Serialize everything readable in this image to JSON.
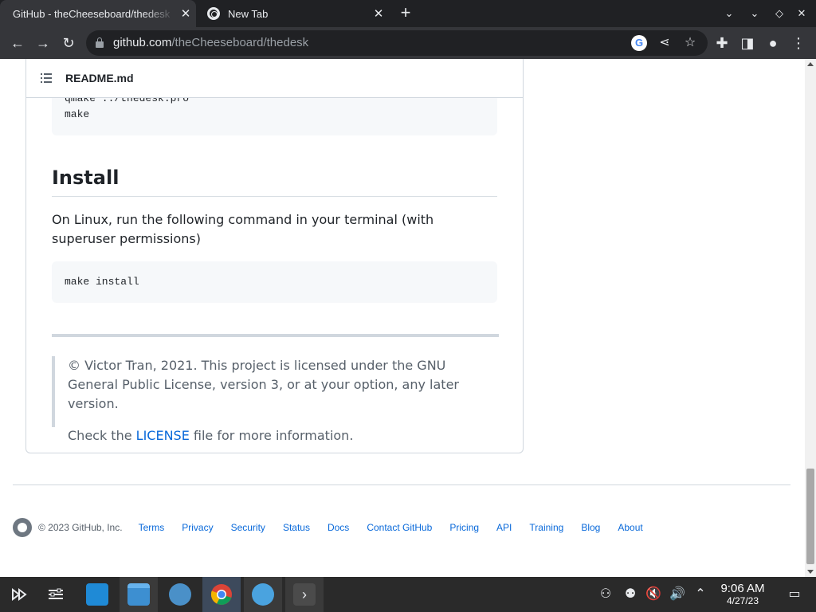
{
  "browser": {
    "tabs": [
      {
        "title": "GitHub - theCheeseboard/thedesk",
        "active": true
      },
      {
        "title": "New Tab",
        "active": false
      }
    ],
    "url_host": "github.com",
    "url_path": "/theCheeseboard/thedesk"
  },
  "readme": {
    "filename": "README.md",
    "build_code": [
      "qmake ../thedesk.pro",
      "make"
    ],
    "install_heading": "Install",
    "install_text": "On Linux, run the following command in your terminal (with superuser permissions)",
    "install_code": "make install",
    "license_text": "© Victor Tran, 2021. This project is licensed under the GNU General Public License, version 3, or at your option, any later version.",
    "check_prefix": "Check the ",
    "license_link": "LICENSE",
    "check_suffix": " file for more information."
  },
  "footer": {
    "copyright": "© 2023 GitHub, Inc.",
    "links": [
      "Terms",
      "Privacy",
      "Security",
      "Status",
      "Docs",
      "Contact GitHub",
      "Pricing",
      "API",
      "Training",
      "Blog",
      "About"
    ]
  },
  "taskbar": {
    "time": "9:06 AM",
    "date": "4/27/23"
  },
  "colors": {
    "link": "#0969da",
    "chrome_dark": "#202124",
    "taskbar": "#2a2a2a"
  }
}
